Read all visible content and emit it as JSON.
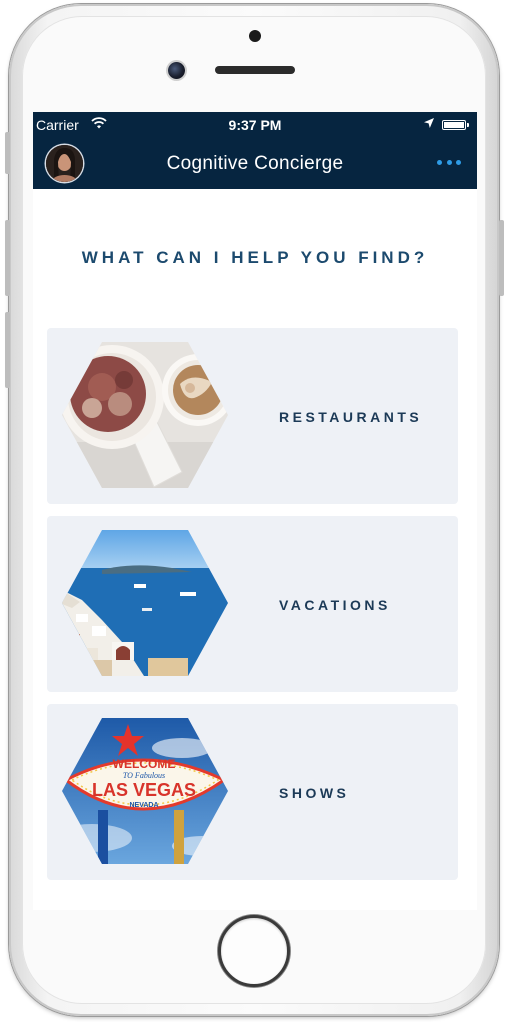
{
  "status_bar": {
    "carrier": "Carrier",
    "time": "9:37 PM"
  },
  "nav": {
    "title": "Cognitive Concierge",
    "menu_icon": "more-horizontal-icon",
    "avatar_icon": "user-avatar"
  },
  "main": {
    "heading": "WHAT CAN I HELP YOU FIND?",
    "categories": [
      {
        "label": "RESTAURANTS",
        "image": "dessert-and-coffee-photo"
      },
      {
        "label": "VACATIONS",
        "image": "santorini-coast-photo"
      },
      {
        "label": "SHOWS",
        "image": "welcome-to-fabulous-las-vegas-sign-photo"
      }
    ]
  },
  "vegas_sign": {
    "line1": "WELCOME",
    "line2": "TO Fabulous",
    "line3": "LAS VEGAS",
    "line4": "NEVADA"
  },
  "colors": {
    "nav_background": "#062540",
    "accent": "#2e9ce6",
    "card_background": "#eef1f6",
    "heading_text": "#1c4a6e"
  }
}
